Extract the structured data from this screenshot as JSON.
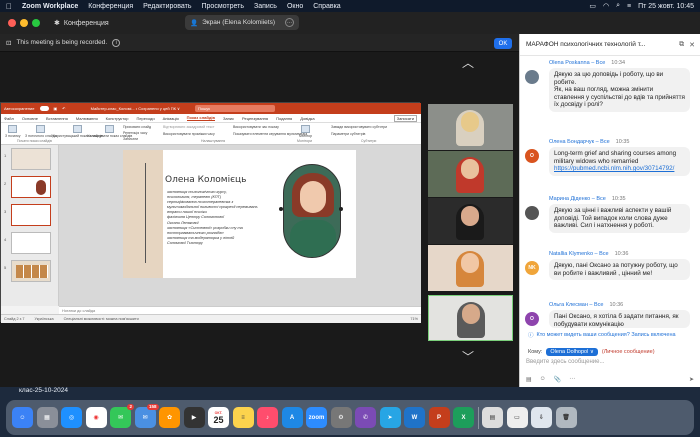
{
  "menubar": {
    "app": "Zoom Workplace",
    "items": [
      "Конференция",
      "Редактировать",
      "Просмотреть",
      "Запись",
      "Окно",
      "Справка"
    ],
    "clock": "Пт 25 жовт.  10:45"
  },
  "zoom": {
    "conf_label": "Конференция",
    "share_label": "Экран (Elena Kolomiiets)",
    "record_notice": "This meeting is being recorded.",
    "ok_label": "OK"
  },
  "ppt": {
    "autosave": "Автосохранение",
    "filename": "Майстер-клас_Коломі...   •  Сохранено у цей ПК ∨",
    "search": "Пошук",
    "menu": [
      "Файл",
      "Основне",
      "Вставлення",
      "Малювання",
      "Конструктор",
      "Переходи",
      "Анімація",
      "Показ слайдів",
      "Запис",
      "Рецензування",
      "Подання",
      "Довідка"
    ],
    "active_menu": "Показ слайдів",
    "record_btn": "Записати",
    "ribbon": {
      "from_start": "З початку",
      "from_current": "З поточного слайда",
      "custom": "Користувацький показ слайдів",
      "setup": "Налаштувати показ слайдів",
      "hide": "Приховати слайд",
      "rehearse": "Репетиція часу",
      "record": "Записати",
      "play_narr": "Відтворювати закадровий текст",
      "use_timing": "Використовувати проміжки часу",
      "media_controls": "Показувати елементи керування мультимедіа",
      "play_timings": "Використовувати час показу",
      "monitor": "Монітор",
      "always_subs": "Завжди використовувати субтитри",
      "subs_params": "Параметри субтитрів",
      "group1": "Почати показ слайдів",
      "group2": "Налаштування",
      "group3": "Монітори",
      "group4": "Субтитри"
    },
    "slide_numbers": [
      "1",
      "2",
      "3",
      "4",
      "5"
    ],
    "slide": {
      "title": "Олена Коломієць",
      "bullets": [
        "засновниця психологічного курсу,",
        "психологиня, терапевт (КПТ)",
        "сертифікованна психотерапевтка з",
        "мультимодальної пиливості прогресії переживань",
        "втрати нашої психіки",
        "фахівчиня Центру Соломонової",
        "Оксани Лелякової",
        "засновниця «Системної» розробки сну та",
        "посттравматичного розладів»",
        "засновниця та модераторка у літній",
        "Соломової Тьютору"
      ]
    },
    "notes": "Нотатки до слайда",
    "status": [
      "Слайд 2 з 7",
      "Українська",
      "Спеціальні можливості: можна пом'якшити"
    ],
    "zoom_level": "71%"
  },
  "chat": {
    "title": "МАРАФОН психологічних технологій т...",
    "messages": [
      {
        "author": "Olena Poskanna – Все",
        "time": "10:34",
        "avatar": "",
        "avatar_color": "#6a7b8c",
        "text": "Дякую за цю доповідь і роботу, що ви робите.\nЯк, на ваш погляд, можна змінити ставлення у суспільстві до вдів та прийняття їх досвіду і ролі?"
      },
      {
        "author": "Олена Бондарчук – Все",
        "time": "10:35",
        "avatar": "О",
        "avatar_color": "#d9541f",
        "text": "Long-term grief and sharing courses among military widows who remarried",
        "link": "https://pubmed.ncbi.nlm.nih.gov/30714792/"
      },
      {
        "author": "Марина Діденко – Все",
        "time": "10:35",
        "avatar": "",
        "avatar_color": "#555",
        "text": "Дякую за цінні і важливі аспекти у вашій доповіді. Той випадок коли слова дуже важливі. Сил і натхнення у роботі."
      },
      {
        "author": "Natallia Klymenko – Все",
        "time": "10:36",
        "avatar": "NK",
        "avatar_color": "#f0a53a",
        "text": "Дякую, пані Оксано за потужну роботу, що ви робите і важливий , цінний ме!"
      },
      {
        "author": "Ольга Клесман – Все",
        "time": "10:36",
        "avatar": "О",
        "avatar_color": "#8e44ad",
        "text": "Пані Оксано, я хотіла б задати питання, як побудувати комунікацію"
      }
    ],
    "who_can": "Кто может видеть ваши сообщения? Запись включена",
    "to_label": "Кому:",
    "to_value": "Olena Dolhopol ∨",
    "to_note": "(Личное сообщение)",
    "input_placeholder": "Введите здесь сообщение..."
  },
  "desktop_label": "клас-25-10-2024",
  "dock": {
    "calendar_month": "ОКТ.",
    "calendar_day": "25",
    "badge1": "2",
    "badge2": "158"
  }
}
